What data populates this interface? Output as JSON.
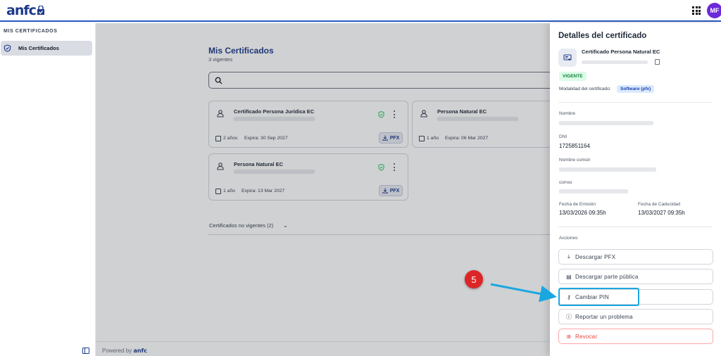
{
  "app": {
    "logo": "anf",
    "avatar_initials": "MF"
  },
  "sidebar": {
    "section_title": "MIS CERTIFICADOS",
    "items": [
      {
        "label": "Mis Certificados",
        "active": true
      }
    ]
  },
  "main": {
    "title": "Mis Certificados",
    "subtitle": "3 vigentes",
    "search": {
      "placeholder": ""
    },
    "cards": [
      {
        "title": "Certificado Persona Jurídica EC",
        "years": "2 años",
        "expires": "Expira: 30 Sep 2027",
        "download_label": "PFX"
      },
      {
        "title": "Persona Natural EC",
        "years": "1 año",
        "expires": "Expira: 06 Mar 2027",
        "download_label": "PFX"
      },
      {
        "title": "Persona Natural EC",
        "years": "1 año",
        "expires": "Expira: 13 Mar 2027",
        "download_label": "PFX"
      }
    ],
    "non_valid_label": "Certificados no vigentes (2)"
  },
  "footer": {
    "powered_by": "Powered by",
    "logo": "anf"
  },
  "panel": {
    "title": "Detalles del certificado",
    "cert_name": "Certificado Persona Natural EC",
    "status_badge": "VIGENTE",
    "modality_label": "Modalidad del certificado:",
    "modality_value": "Software (pfx)",
    "fields": {
      "nombre_label": "Nombre",
      "dni_label": "DNI",
      "dni_value": "1725851164",
      "common_name_label": "Nombre común",
      "email_label": "correo",
      "issue_label": "Fecha de Emisión",
      "issue_value": "13/03/2026 09:35h",
      "expiry_label": "Fecha de Caducidad",
      "expiry_value": "13/03/2027 09:35h"
    },
    "actions_label": "Acciones",
    "actions": [
      {
        "label": "Descargar PFX",
        "icon": "download-icon"
      },
      {
        "label": "Descargar parte pública",
        "icon": "document-icon"
      },
      {
        "label": "Cambiar PIN",
        "icon": "key-icon"
      },
      {
        "label": "Reportar un problema",
        "icon": "alert-icon"
      },
      {
        "label": "Revocar",
        "icon": "cancel-icon"
      }
    ]
  },
  "annotation": {
    "step_number": "5",
    "color": "#1aa7e0",
    "badge_color": "#dc2626"
  }
}
